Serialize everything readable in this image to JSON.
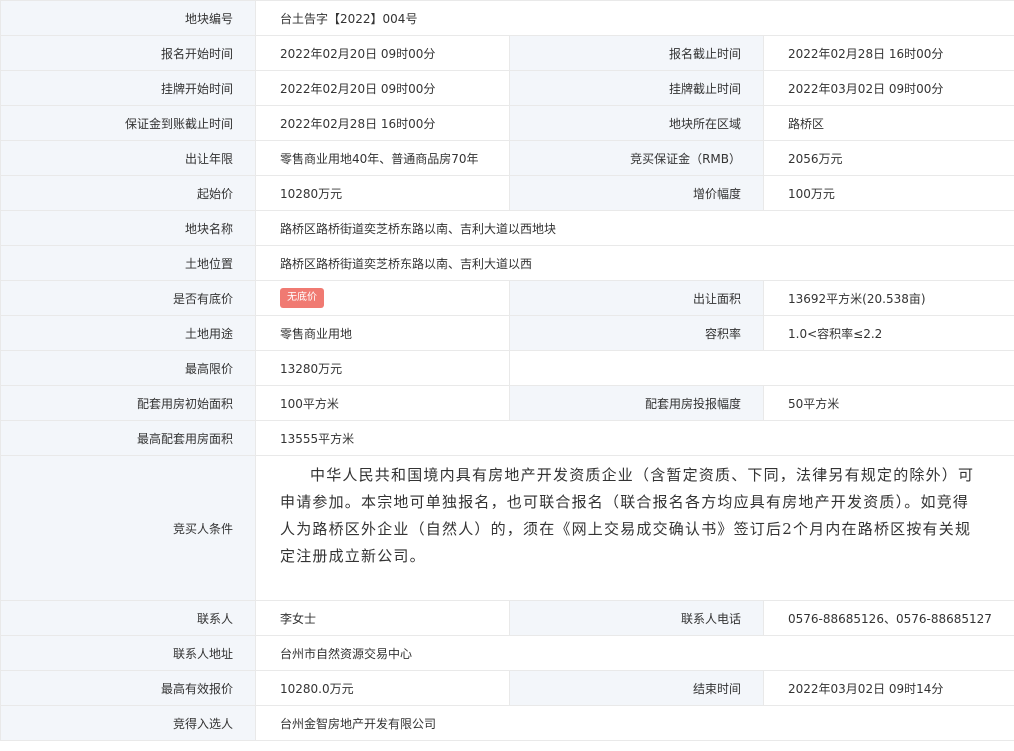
{
  "labels": {
    "parcel_no": "地块编号",
    "reg_start": "报名开始时间",
    "reg_end": "报名截止时间",
    "list_start": "挂牌开始时间",
    "list_end": "挂牌截止时间",
    "deposit_deadline": "保证金到账截止时间",
    "region": "地块所在区域",
    "term": "出让年限",
    "deposit": "竞买保证金（RMB）",
    "start_price": "起始价",
    "increment": "增价幅度",
    "parcel_name": "地块名称",
    "location": "土地位置",
    "reserve": "是否有底价",
    "area": "出让面积",
    "usage": "土地用途",
    "far": "容积率",
    "max_price": "最高限价",
    "housing_initial": "配套用房初始面积",
    "housing_step": "配套用房投报幅度",
    "housing_max": "最高配套用房面积",
    "bidder_conditions": "竞买人条件",
    "contact": "联系人",
    "phone": "联系人电话",
    "address": "联系人地址",
    "highest_bid": "最高有效报价",
    "end_time": "结束时间",
    "winner": "竞得入选人"
  },
  "values": {
    "parcel_no": "台土告字【2022】004号",
    "reg_start": "2022年02月20日 09时00分",
    "reg_end": "2022年02月28日 16时00分",
    "list_start": "2022年02月20日 09时00分",
    "list_end": "2022年03月02日 09时00分",
    "deposit_deadline": "2022年02月28日 16时00分",
    "region": "路桥区",
    "term": "零售商业用地40年、普通商品房70年",
    "deposit": "2056万元",
    "start_price": "10280万元",
    "increment": "100万元",
    "parcel_name": "路桥区路桥街道奕芝桥东路以南、吉利大道以西地块",
    "location": "路桥区路桥街道奕芝桥东路以南、吉利大道以西",
    "reserve_badge": "无底价",
    "area": "13692平方米(20.538亩)",
    "usage": "零售商业用地",
    "far": "1.0<容积率≤2.2",
    "max_price": "13280万元",
    "housing_initial": "100平方米",
    "housing_step": "50平方米",
    "housing_max": "13555平方米",
    "bidder_conditions": "中华人民共和国境内具有房地产开发资质企业（含暂定资质、下同，法律另有规定的除外）可申请参加。本宗地可单独报名，也可联合报名（联合报名各方均应具有房地产开发资质）。如竞得人为路桥区外企业（自然人）的，须在《网上交易成交确认书》签订后2个月内在路桥区按有关规定注册成立新公司。",
    "contact": "李女士",
    "phone": "0576-88685126、0576-88685127",
    "address": "台州市自然资源交易中心",
    "highest_bid": "10280.0万元",
    "end_time": "2022年03月02日 09时14分",
    "winner": "台州金智房地产开发有限公司"
  },
  "colors": {
    "label_bg": "#f3f6fa",
    "border": "#e9e9e9",
    "badge_bg": "#f07a72"
  }
}
